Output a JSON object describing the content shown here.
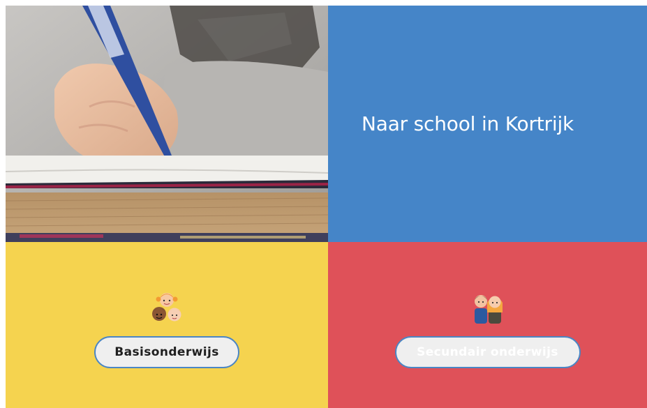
{
  "hero": {
    "title": "Naar school in Kortrijk",
    "background_color": "#4585c8",
    "image_subject": "child-writing-in-notebook-photo"
  },
  "tiles": [
    {
      "label": "Basisonderwijs",
      "icon": "young-children-icon",
      "background_color": "#f5d34f",
      "text_color": "#1f1f1f"
    },
    {
      "label": "Secundair onderwijs",
      "icon": "teenagers-icon",
      "background_color": "#df5159",
      "text_color": "#ffffff"
    }
  ],
  "colors": {
    "button_border": "#4b86c4"
  }
}
